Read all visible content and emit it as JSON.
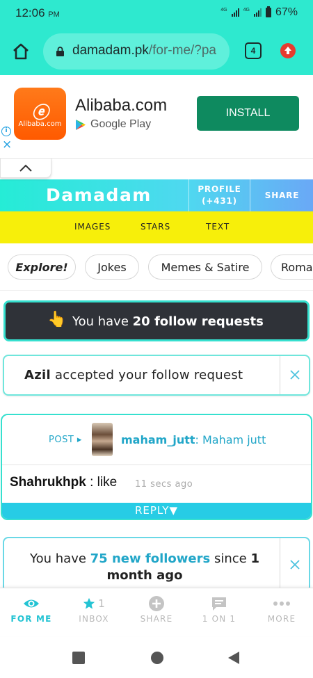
{
  "status_bar": {
    "time": "12:06",
    "ampm": "PM",
    "battery": "67%",
    "net1": "4G",
    "net2": "4G"
  },
  "browser": {
    "url_host": "damadam.pk",
    "url_path": "/for-me/?pa",
    "tab_count": "4"
  },
  "ad": {
    "brand_title": "Alibaba.com",
    "logo_glyph": "🄰",
    "logo_text": "Alibaba.com",
    "store": "Google Play",
    "install_label": "INSTALL",
    "info_icon": "i",
    "close_icon": "×"
  },
  "header": {
    "logo": "Damadam",
    "profile_label": "PROFILE",
    "profile_count": "(+431)",
    "share_label": "SHARE"
  },
  "subnav": {
    "images": "IMAGES",
    "stars": "STARS",
    "text": "TEXT"
  },
  "chips": [
    "Explore!",
    "Jokes",
    "Memes & Satire",
    "Roma"
  ],
  "follow_requests": {
    "prefix": "You have ",
    "strong": "20 follow requests"
  },
  "accepted": {
    "user": "Azil",
    "text": " accepted your follow request"
  },
  "post": {
    "type_label": "POST ▸",
    "author_handle": "maham_jutt",
    "author_name": ": Maham jutt",
    "commenter": "Shahrukhpk",
    "comment": " : like",
    "time": "11 secs ago",
    "reply_label": "REPLY▼"
  },
  "followers": {
    "prefix": "You have ",
    "count_text": "75 new followers",
    "middle": " since ",
    "bold": "1 month ago"
  },
  "bottom_nav": [
    {
      "label": "FOR ME",
      "icon": "eye-icon",
      "active": true
    },
    {
      "label": "INBOX",
      "icon": "star-icon",
      "badge": "1"
    },
    {
      "label": "SHARE",
      "icon": "plus-circle-icon"
    },
    {
      "label": "1 ON 1",
      "icon": "chat-icon"
    },
    {
      "label": "MORE",
      "icon": "more-dots-icon"
    }
  ],
  "colors": {
    "accent": "#2ee9cf",
    "nav_active": "#23c3d3",
    "yellow": "#f7ef0a",
    "dark_card": "#2f3238",
    "install": "#0e8a5f"
  }
}
